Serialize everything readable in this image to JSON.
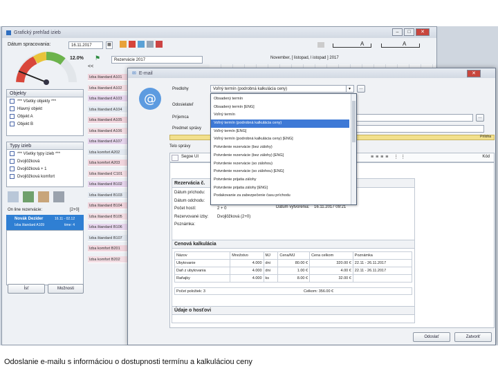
{
  "main": {
    "title": "Grafický prehľad izieb",
    "date_label": "Dátum spracovania:",
    "date_value": "16.11.2017",
    "gauge_pct": "12.0%",
    "ruler_a": "A",
    "ruler_b": "A",
    "toolbar_nav": "<<",
    "object_select": "Rezervácie 2017",
    "period_label": "November, [ listopad, l istopad ] 2017",
    "objects_header": "Objekty",
    "objects": [
      "*** Všetky objekty ***",
      "Hlavný objekt",
      "Objekt A",
      "Objekt B"
    ],
    "roomtypes_header": "Typy izieb",
    "roomtypes": [
      "*** Všetky typy izieb ***",
      "Dvojlôžková",
      "Dvojlôžková + 1",
      "Dvojlôžková komfort"
    ],
    "rooms": [
      "Izba štandard A101",
      "Izba štandard A102",
      "Izba štandard A103",
      "Izba štandard A104",
      "Izba štandard A105",
      "Izba štandard A106",
      "Izba štandard A107",
      "Izba komfort A202",
      "Izba komfort A203",
      "Izba štandard C101",
      "Izba štandard B102",
      "Izba štandard B103",
      "Izba štandard B104",
      "Izba štandard B105",
      "Izba štandard B106",
      "Izba štandard B107",
      "Izba komfort B201",
      "Izba komfort B202"
    ],
    "online_label": "On line rezervácie:",
    "online_count": "[2+0]",
    "online_item_name": "Novák Dezider",
    "online_item_detail": "Izba štandard A109",
    "online_item_dates": "16.11 - 02.12",
    "online_item_time": "time: 4",
    "btn_left": "Ísť",
    "btn_right": "Možnosti"
  },
  "dialog": {
    "title": "E-mail",
    "template_label": "Predlohy",
    "template_value": "Voľný termín (podrobná kalkulácia ceny)",
    "from_label": "Odosielateľ",
    "to_label": "Príjemca",
    "subject_label": "Predmet správy",
    "attachment_label": "Príloha",
    "body_label": "Telo správy",
    "font_name": "Segoe UI",
    "code_btn": "Kód",
    "options": [
      "Obsadený termín",
      "Obsadený termín [ENG]",
      "Voľný termín",
      "Voľný termín (podrobná kalkulácia ceny)",
      "Voľný termín [ENG]",
      "Voľný termín (podrobná kalkulácia ceny) [ENG]",
      "Potvrdenie rezervácie (bez zálohy)",
      "Potvrdenie rezervácie (bez zálohy) [ENG]",
      "Potvrdenie rezervácie (so zálohou)",
      "Potvrdenie rezervácie (so zálohou) [ENG]",
      "Potvrdenie prijatia zálohy",
      "Potvrdenie prijatia zálohy [ENG]",
      "Podakovanie za zabezpečenie času príchodu"
    ],
    "selected_option_index": 3,
    "doc": {
      "reservation_header": "Rezervácia č.",
      "rows": [
        {
          "label": "Dátum príchodu:",
          "value": ""
        },
        {
          "label": "Dátum odchodu:",
          "value": ""
        },
        {
          "label": "Počet hostí:",
          "value": "2 + 0"
        },
        {
          "label": "Rezervované izby:",
          "value": "Dvojlôžková (2+0)"
        },
        {
          "label": "Poznámka:",
          "value": ""
        }
      ],
      "created_text": "Dátum vytvorenia:",
      "created_value": "16.11.2017 09:21",
      "price_header": "Cenová kalkulácia",
      "price_columns": [
        "Názov",
        "Množstvo",
        "MJ",
        "Cena/MJ",
        "Cena celkom",
        "Poznámka"
      ],
      "price_rows": [
        [
          "Ubytovanie",
          "4.000",
          "dni",
          "80.00 €",
          "320.00 €",
          "22.11 - 26.11.2017"
        ],
        [
          "Daň z ubytovania",
          "4.000",
          "dni",
          "1.00 €",
          "4.00 €",
          "22.11 - 26.11.2017"
        ],
        [
          "Raňajky",
          "4.000",
          "ks",
          "8.00 €",
          "32.00 €",
          ""
        ]
      ],
      "total_count": "Počet položiek: 3",
      "total_label": "Celkom: 356.00 €",
      "guests_header": "Údaje o hosťovi"
    },
    "btn_send": "Odoslať",
    "btn_close": "Zatvoriť"
  },
  "caption": "Odoslanie e-mailu s informáciou o dostupnosti termínu a kalkuláciou ceny"
}
